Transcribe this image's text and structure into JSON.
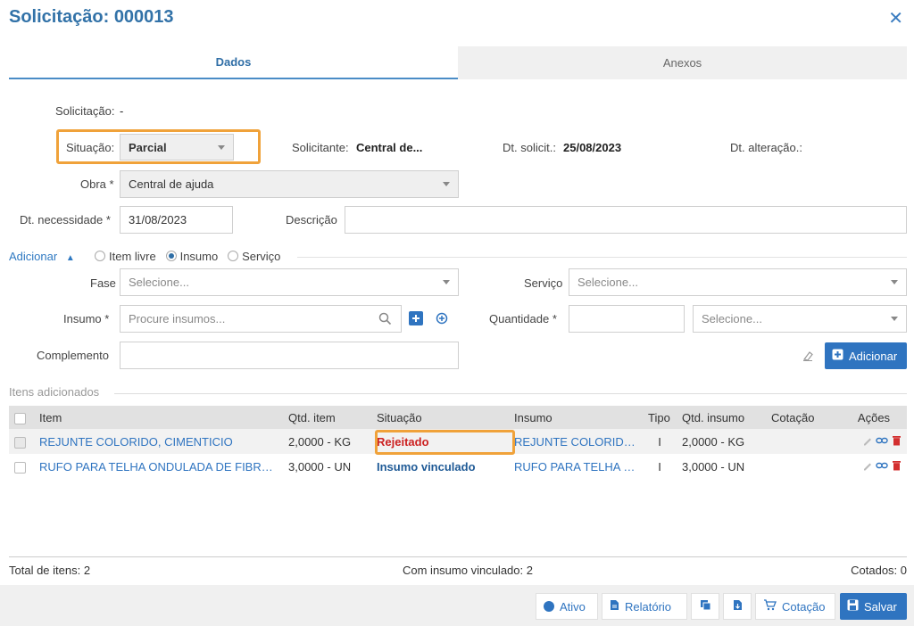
{
  "header": {
    "title": "Solicitação: 000013",
    "close_glyph": "✕"
  },
  "tabs": [
    {
      "label": "Dados"
    },
    {
      "label": "Anexos"
    }
  ],
  "form": {
    "solicitacao_label": "Solicitação:",
    "solicitacao_value": "-",
    "situacao_label": "Situação:",
    "situacao_value": "Parcial",
    "solicitante_label": "Solicitante:",
    "solicitante_value": "Central de...",
    "dt_solicit_label": "Dt. solicit.:",
    "dt_solicit_value": "25/08/2023",
    "dt_alteracao_label": "Dt. alteração.:",
    "obra_label": "Obra *",
    "obra_value": "Central de ajuda",
    "dt_necessidade_label": "Dt. necessidade *",
    "dt_necessidade_value": "31/08/2023",
    "descricao_label": "Descrição"
  },
  "adicionar": {
    "title": "Adicionar",
    "radios": [
      {
        "label": "Item livre",
        "checked": false
      },
      {
        "label": "Insumo",
        "checked": true
      },
      {
        "label": "Serviço",
        "checked": false
      }
    ],
    "fase_label": "Fase",
    "fase_placeholder": "Selecione...",
    "servico_label": "Serviço",
    "servico_placeholder": "Selecione...",
    "insumo_label": "Insumo *",
    "insumo_placeholder": "Procure insumos...",
    "quantidade_label": "Quantidade *",
    "unidade_placeholder": "Selecione...",
    "complemento_label": "Complemento",
    "add_button": "Adicionar"
  },
  "items": {
    "section_title": "Itens adicionados",
    "columns": [
      "Item",
      "Qtd. item",
      "Situação",
      "Insumo",
      "Tipo",
      "Qtd. insumo",
      "Cotação",
      "Ações"
    ],
    "rows": [
      {
        "item": "REJUNTE COLORIDO, CIMENTICIO",
        "qtd_item": "2,0000 - KG",
        "situacao": "Rejeitado",
        "insumo": "REJUNTE COLORIDO, ...",
        "tipo": "I",
        "qtd_insumo": "2,0000 - KG",
        "cotacao": ""
      },
      {
        "item": "RUFO PARA TELHA ONDULADA DE FIBRO...",
        "qtd_item": "3,0000 - UN",
        "situacao": "Insumo vinculado",
        "insumo": "RUFO PARA TELHA O...",
        "tipo": "I",
        "qtd_insumo": "3,0000 - UN",
        "cotacao": ""
      }
    ]
  },
  "footer": {
    "total": "Total de itens: 2",
    "vinculado": "Com insumo vinculado: 2",
    "cotados": "Cotados: 0"
  },
  "toolbar": {
    "ativo": "Ativo",
    "relatorio": "Relatório",
    "cotacao": "Cotação",
    "salvar": "Salvar"
  },
  "colors": {
    "accent": "#2f74c0",
    "highlight": "#f0a23a",
    "rejected": "#cc2222"
  }
}
